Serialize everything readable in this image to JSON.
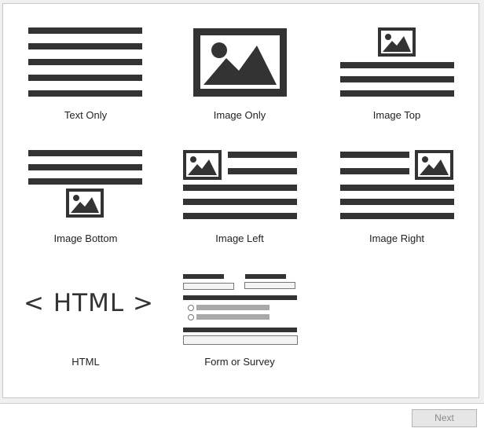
{
  "colors": {
    "icon": "#333333",
    "panel": "#ffffff",
    "background": "#f0f0f0",
    "disabled_text": "#8a8a8a"
  },
  "layouts": [
    {
      "label": "Text Only",
      "icon": "text-lines-icon"
    },
    {
      "label": "Image Only",
      "icon": "image-icon"
    },
    {
      "label": "Image Top",
      "icon": "image-top-icon"
    },
    {
      "label": "Image Bottom",
      "icon": "image-bottom-icon"
    },
    {
      "label": "Image Left",
      "icon": "image-left-icon"
    },
    {
      "label": "Image Right",
      "icon": "image-right-icon"
    },
    {
      "label": "HTML",
      "icon": "html-icon",
      "glyph": "< HTML >"
    },
    {
      "label": "Form or Survey",
      "icon": "form-icon"
    }
  ],
  "footer": {
    "next_label": "Next",
    "next_enabled": false
  }
}
